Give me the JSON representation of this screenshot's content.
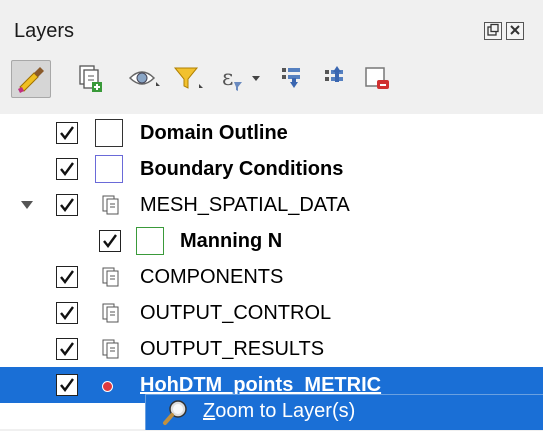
{
  "panel": {
    "title": "Layers",
    "float_icon": "float-panel-icon",
    "close_icon": "close-panel-icon"
  },
  "toolbar": {
    "buttons": [
      {
        "name": "style-panel-icon",
        "active": true
      },
      {
        "name": "add-group-icon"
      },
      {
        "name": "manage-visibility-icon"
      },
      {
        "name": "filter-legend-icon"
      },
      {
        "name": "filter-expression-icon"
      },
      {
        "name": "expand-all-icon"
      },
      {
        "name": "collapse-all-icon"
      },
      {
        "name": "remove-layer-icon"
      }
    ]
  },
  "layers": [
    {
      "label": "Domain Outline",
      "checked": true,
      "type": "polygon",
      "bold": true,
      "symbol_color": "#333333"
    },
    {
      "label": "Boundary Conditions",
      "checked": true,
      "type": "polygon",
      "bold": true,
      "symbol_color": "#6a6ad8"
    },
    {
      "label": "MESH_SPATIAL_DATA",
      "checked": true,
      "type": "group",
      "expanded": true
    },
    {
      "label": "Manning N",
      "checked": true,
      "type": "polygon",
      "bold": true,
      "symbol_color": "#3a9a3a",
      "indent": 1
    },
    {
      "label": "COMPONENTS",
      "checked": true,
      "type": "group"
    },
    {
      "label": "OUTPUT_CONTROL",
      "checked": true,
      "type": "group"
    },
    {
      "label": "OUTPUT_RESULTS",
      "checked": true,
      "type": "group"
    },
    {
      "label": "HohDTM_points_METRIC",
      "checked": true,
      "type": "point",
      "selected": true,
      "symbol_color": "#e0393e"
    }
  ],
  "context_menu": {
    "items": [
      {
        "label_first": "Z",
        "label_rest": "oom to Layer(s)",
        "icon": "zoom-layer-icon"
      }
    ]
  },
  "colors": {
    "selection": "#1a6fd6",
    "panel_bg": "#f0f0f0",
    "tree_bg": "#ffffff"
  }
}
